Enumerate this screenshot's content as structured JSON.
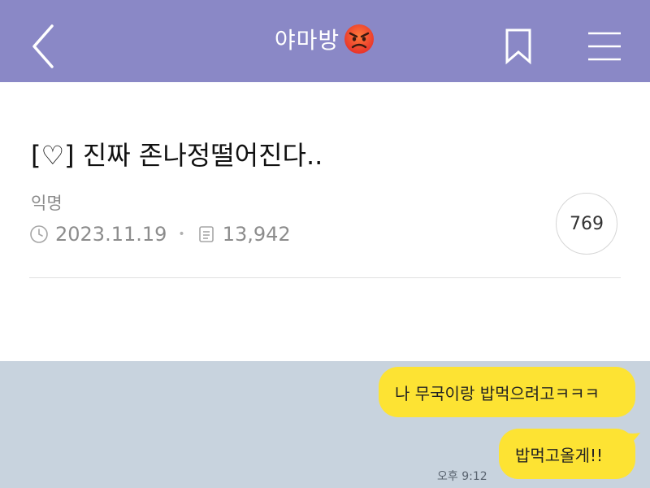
{
  "header": {
    "title": "야마방",
    "title_emoji": "angry-face-icon",
    "background_color": "#8a88c6",
    "back_icon": "chevron-left-icon",
    "bookmark_icon": "bookmark-icon",
    "menu_icon": "hamburger-menu-icon"
  },
  "post": {
    "title": "[♡] 진짜 존나정떨어진다..",
    "author": "익명",
    "date": "2023.11.19",
    "views": "13,942",
    "comment_count": "769",
    "date_icon": "clock-icon",
    "views_icon": "document-icon"
  },
  "chat": {
    "background_color": "#c8d3de",
    "bubble_color": "#fde333",
    "messages": [
      {
        "text": "나 무국이랑 밥먹으려고ㅋㅋㅋ"
      },
      {
        "text": "밥먹고올게!!"
      }
    ],
    "timestamp": "오후 9:12"
  }
}
